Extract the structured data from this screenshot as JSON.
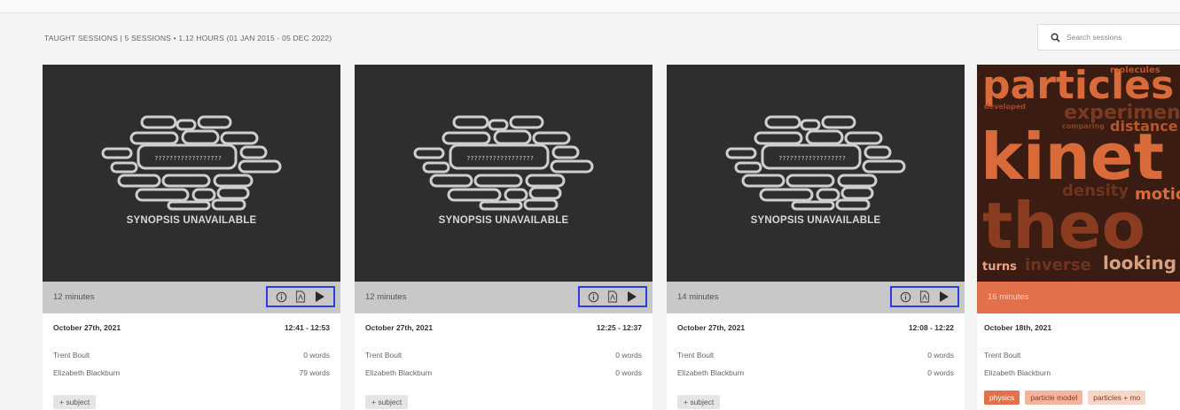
{
  "header": {
    "summary": "TAUGHT SESSIONS | 5 SESSIONS • 1.12 HOURS (01 JAN 2015 - 05 DEC 2022)"
  },
  "search": {
    "placeholder": "Search sessions",
    "icon": "search-icon"
  },
  "cards": [
    {
      "synopsis": "SYNOPSIS UNAVAILABLE",
      "duration": "12 minutes",
      "date": "October 27th, 2021",
      "time": "12:41 - 12:53",
      "speakers": [
        {
          "name": "Trent Boult",
          "words": "0 words"
        },
        {
          "name": "Elizabeth Blackburn",
          "words": "79 words"
        }
      ],
      "tag": "+ subject"
    },
    {
      "synopsis": "SYNOPSIS UNAVAILABLE",
      "duration": "12 minutes",
      "date": "October 27th, 2021",
      "time": "12:25 - 12:37",
      "speakers": [
        {
          "name": "Trent Boult",
          "words": "0 words"
        },
        {
          "name": "Elizabeth Blackburn",
          "words": "0 words"
        }
      ],
      "tag": "+ subject"
    },
    {
      "synopsis": "SYNOPSIS UNAVAILABLE",
      "duration": "14 minutes",
      "date": "October 27th, 2021",
      "time": "12:08 - 12:22",
      "speakers": [
        {
          "name": "Trent Boult",
          "words": "0 words"
        },
        {
          "name": "Elizabeth Blackburn",
          "words": "0 words"
        }
      ],
      "tag": "+ subject"
    },
    {
      "duration": "16 minutes",
      "date": "October 18th, 2021",
      "speakers": [
        {
          "name": "Trent Boult"
        },
        {
          "name": "Elizabeth Blackburn"
        }
      ],
      "wordcloud": [
        "particles",
        "kinet",
        "theo",
        "experiment",
        "distance",
        "density",
        "motio",
        "looking",
        "inverse",
        "turns",
        "developed",
        "molecules",
        "comparing"
      ],
      "tags": [
        "physics",
        "particle model",
        "particles + mo"
      ]
    }
  ],
  "colors": {
    "highlight": "#2a3fe0",
    "accent": "#e2704a"
  }
}
